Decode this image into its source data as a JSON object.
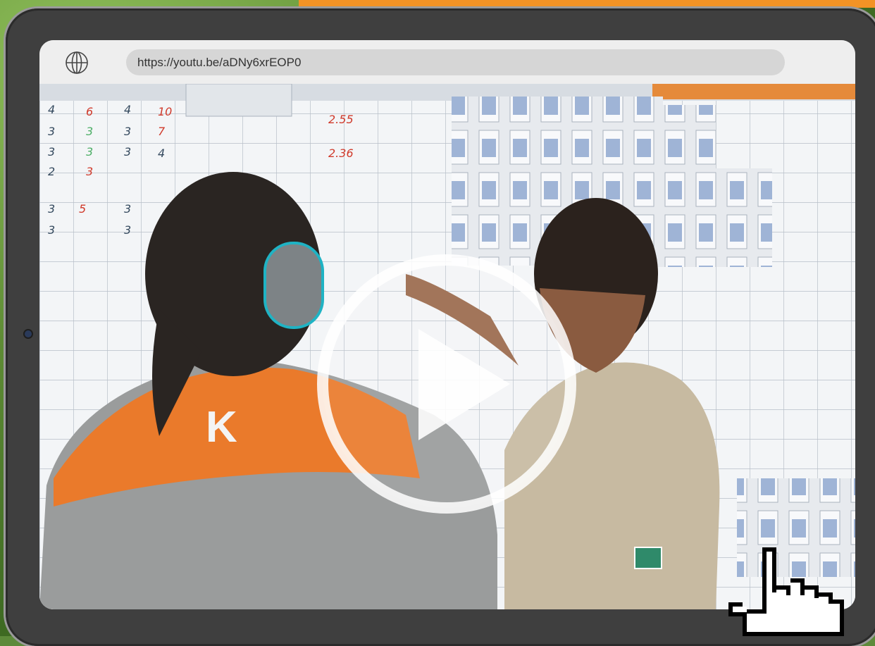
{
  "browser": {
    "url": "https://youtu.be/aDNy6xrEOP0",
    "globe_icon": "globe-icon"
  },
  "video": {
    "play_icon": "play-icon",
    "shirt_logo": "K"
  },
  "cursor": {
    "icon": "hand-pointer-icon"
  },
  "colors": {
    "accent_orange": "#f39325",
    "frame": "#3f3f3f",
    "url_field": "#d6d6d6"
  }
}
